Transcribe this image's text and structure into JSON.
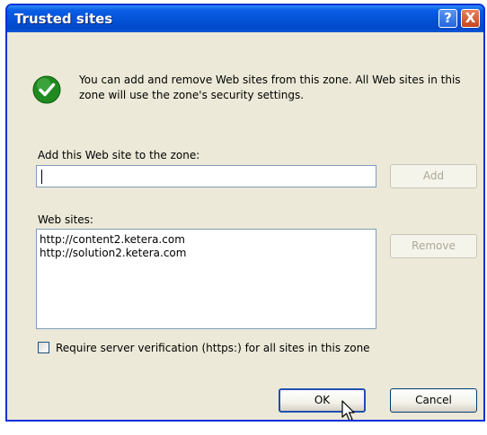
{
  "dialog": {
    "title": "Trusted sites",
    "help_glyph": "?",
    "close_glyph": "X"
  },
  "info": {
    "icon": "checkmark-icon",
    "text": "You can add and remove Web sites from this zone. All Web sites in this zone will use the zone's security settings."
  },
  "add_site": {
    "label": "Add this Web site to the zone:",
    "value": "",
    "add_button": "Add"
  },
  "websites": {
    "label": "Web sites:",
    "items": [
      "http://content2.ketera.com",
      "http://solution2.ketera.com"
    ],
    "remove_button": "Remove"
  },
  "https_verification": {
    "label": "Require server verification (https:) for all sites in this zone",
    "checked": false
  },
  "footer": {
    "ok_button": "OK",
    "cancel_button": "Cancel"
  },
  "colors": {
    "titlebar": "#0553d8",
    "dialog_bg": "#ece9d8",
    "check_green": "#1f8a1f"
  }
}
